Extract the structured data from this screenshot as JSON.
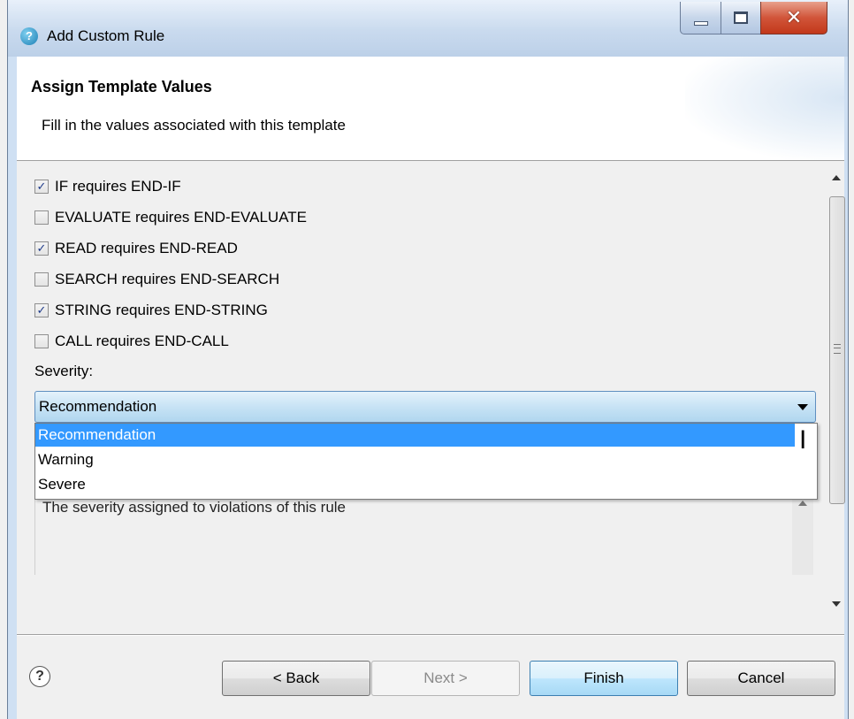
{
  "window": {
    "title": "Add Custom Rule",
    "icon": "app-logo-icon",
    "controls": [
      "minimize",
      "maximize",
      "close"
    ]
  },
  "header": {
    "title": "Assign Template Values",
    "description": "Fill in the values associated with this template"
  },
  "checkboxes": [
    {
      "label": "IF requires END-IF",
      "checked": true
    },
    {
      "label": "EVALUATE requires END-EVALUATE",
      "checked": false
    },
    {
      "label": "READ requires END-READ",
      "checked": true
    },
    {
      "label": "SEARCH requires END-SEARCH",
      "checked": false
    },
    {
      "label": "STRING requires END-STRING",
      "checked": true
    },
    {
      "label": "CALL requires END-CALL",
      "checked": false
    }
  ],
  "severity": {
    "label": "Severity:",
    "selected": "Recommendation",
    "options": [
      "Recommendation",
      "Warning",
      "Severe"
    ],
    "description": "The severity assigned to violations of this rule"
  },
  "buttons": {
    "back": "< Back",
    "next": "Next >",
    "finish": "Finish",
    "cancel": "Cancel"
  },
  "colors": {
    "selection": "#3399ff",
    "combo": "#c7e3f5"
  }
}
